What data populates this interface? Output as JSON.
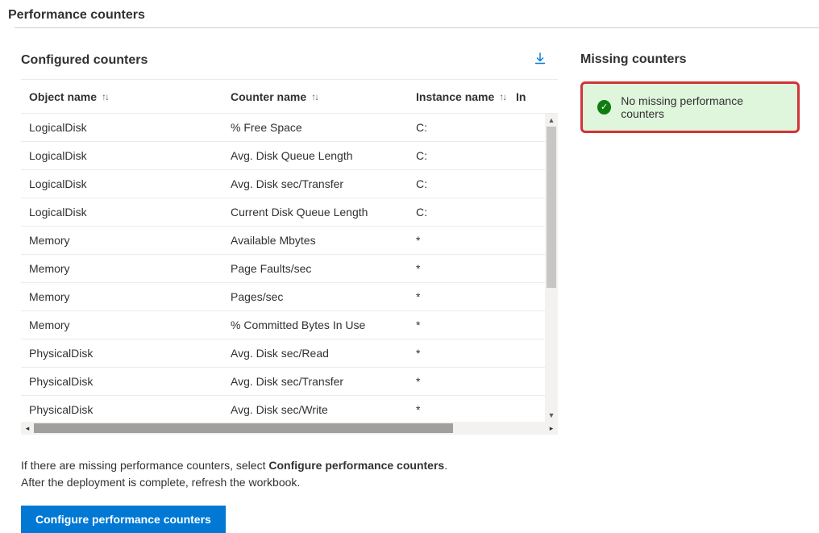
{
  "title": "Performance counters",
  "left": {
    "heading": "Configured counters",
    "columns": {
      "object": "Object name",
      "counter": "Counter name",
      "instance": "Instance name",
      "in": "In"
    },
    "rows": [
      {
        "object": "LogicalDisk",
        "counter": "% Free Space",
        "instance": "C:"
      },
      {
        "object": "LogicalDisk",
        "counter": "Avg. Disk Queue Length",
        "instance": "C:"
      },
      {
        "object": "LogicalDisk",
        "counter": "Avg. Disk sec/Transfer",
        "instance": "C:"
      },
      {
        "object": "LogicalDisk",
        "counter": "Current Disk Queue Length",
        "instance": "C:"
      },
      {
        "object": "Memory",
        "counter": "Available Mbytes",
        "instance": "*"
      },
      {
        "object": "Memory",
        "counter": "Page Faults/sec",
        "instance": "*"
      },
      {
        "object": "Memory",
        "counter": "Pages/sec",
        "instance": "*"
      },
      {
        "object": "Memory",
        "counter": "% Committed Bytes In Use",
        "instance": "*"
      },
      {
        "object": "PhysicalDisk",
        "counter": "Avg. Disk sec/Read",
        "instance": "*"
      },
      {
        "object": "PhysicalDisk",
        "counter": "Avg. Disk sec/Transfer",
        "instance": "*"
      },
      {
        "object": "PhysicalDisk",
        "counter": "Avg. Disk sec/Write",
        "instance": "*"
      }
    ],
    "note_prefix": "If there are missing performance counters, select ",
    "note_bold": "Configure performance counters",
    "note_suffix_line1": ".",
    "note_line2": "After the deployment is complete, refresh the workbook.",
    "button": "Configure performance counters"
  },
  "right": {
    "heading": "Missing counters",
    "ok_message": "No missing performance counters"
  },
  "colors": {
    "primary": "#0078d4",
    "success_bg": "#dff6dd",
    "success_fg": "#107c10",
    "highlight_border": "#d13438"
  }
}
